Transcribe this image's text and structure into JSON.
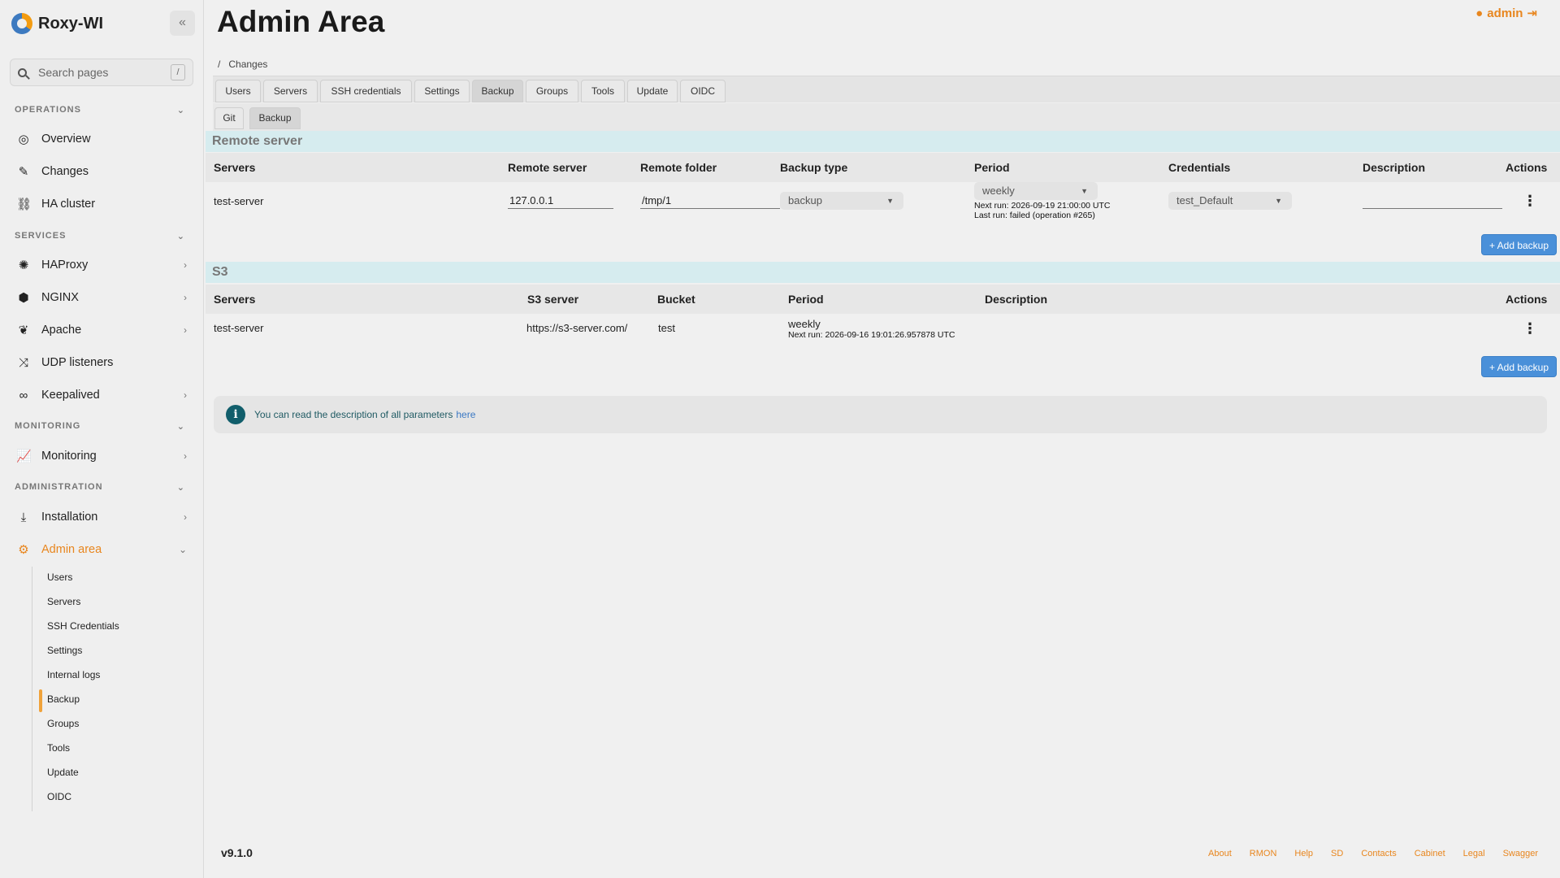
{
  "brand": {
    "name": "Roxy-WI"
  },
  "sidebar": {
    "collapse_label": "«",
    "search_placeholder": "Search pages",
    "search_shortcut": "/",
    "sections": {
      "operations": "OPERATIONS",
      "services": "SERVICES",
      "monitoring": "MONITORING",
      "administration": "ADMINISTRATION"
    },
    "items": {
      "overview": "Overview",
      "changes": "Changes",
      "ha_cluster": "HA cluster",
      "haproxy": "HAProxy",
      "nginx": "NGINX",
      "apache": "Apache",
      "udp_listeners": "UDP listeners",
      "keepalived": "Keepalived",
      "monitoring": "Monitoring",
      "installation": "Installation",
      "admin_area": "Admin area"
    },
    "admin_sub": [
      "Users",
      "Servers",
      "SSH Credentials",
      "Settings",
      "Internal logs",
      "Backup",
      "Groups",
      "Tools",
      "Update",
      "OIDC"
    ]
  },
  "header": {
    "title": "Admin Area",
    "user": "admin",
    "breadcrumb_sep": "/",
    "breadcrumb": "Changes"
  },
  "tabs": [
    "Users",
    "Servers",
    "SSH credentials",
    "Settings",
    "Backup",
    "Groups",
    "Tools",
    "Update",
    "OIDC"
  ],
  "subtabs": [
    "Git",
    "Backup"
  ],
  "remote": {
    "title": "Remote server",
    "columns": [
      "Servers",
      "Remote server",
      "Remote folder",
      "Backup type",
      "Period",
      "Credentials",
      "Description",
      "Actions"
    ],
    "row": {
      "server": "test-server",
      "remote_server": "127.0.0.1",
      "remote_folder": "/tmp/1",
      "backup_type": "backup",
      "period": "weekly",
      "next_run": "Next run: 2026-09-19 21:00:00 UTC",
      "last_run": "Last run: failed (operation #265)",
      "credentials": "test_Default",
      "description": ""
    },
    "add_label": "+ Add backup"
  },
  "s3": {
    "title": "S3",
    "columns": [
      "Servers",
      "S3 server",
      "Bucket",
      "Period",
      "Description",
      "Actions"
    ],
    "row": {
      "server": "test-server",
      "s3_server": "https://s3-server.com/",
      "bucket": "test",
      "period": "weekly",
      "next_run": "Next run: 2026-09-16 19:01:26.957878 UTC"
    },
    "add_label": "+ Add backup"
  },
  "info": {
    "text": "You can read the description of all parameters",
    "link": "here"
  },
  "footer": {
    "version": "v9.1.0",
    "links": [
      "About",
      "RMON",
      "Help",
      "SD",
      "Contacts",
      "Cabinet",
      "Legal",
      "Swagger"
    ]
  },
  "colors": {
    "accent": "#e8861e",
    "button": "#4a90d9",
    "section_bar": "#d6ecef"
  }
}
